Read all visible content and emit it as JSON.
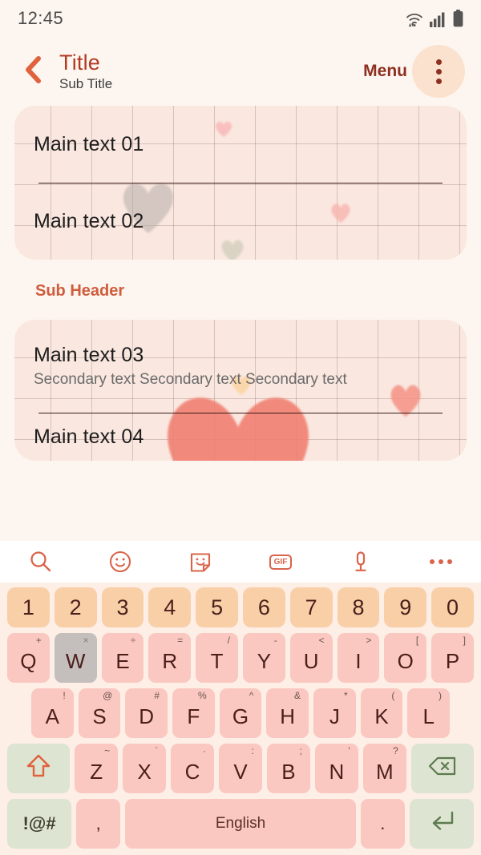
{
  "statusbar": {
    "time": "12:45",
    "icons": [
      "wifi-icon",
      "cellular-signal-icon",
      "battery-icon"
    ]
  },
  "appbar": {
    "back_icon": "chevron-left-icon",
    "title": "Title",
    "subtitle": "Sub Title",
    "menu_label": "Menu",
    "overflow_icon": "more-vertical-icon"
  },
  "colors": {
    "page_bg": "#fdf6f0",
    "card_bg": "#fae8e0",
    "accent_title": "#b23a23",
    "accent_menu": "#8e2f20",
    "sub_header": "#cf5c3c",
    "key_number": "#f9cfa8",
    "key_letter": "#fac8c0",
    "key_special": "#dde4d1",
    "key_pressed": "#c4bebc",
    "toolbar_icon": "#d9644a",
    "keyboard_bg": "#fdeee6"
  },
  "content": {
    "card1": {
      "rows": [
        {
          "main": "Main text 01"
        },
        {
          "main": "Main text 02"
        }
      ]
    },
    "sub_header": "Sub Header",
    "card2": {
      "rows": [
        {
          "main": "Main text 03",
          "secondary": "Secondary text Secondary text Secondary text"
        },
        {
          "main": "Main text 04"
        }
      ]
    }
  },
  "keyboard": {
    "toolbar": [
      {
        "name": "search-icon",
        "label": ""
      },
      {
        "name": "emoji-icon",
        "label": ""
      },
      {
        "name": "sticker-icon",
        "label": ""
      },
      {
        "name": "gif-icon",
        "label": "GIF"
      },
      {
        "name": "microphone-icon",
        "label": ""
      },
      {
        "name": "more-horizontal-icon",
        "label": ""
      }
    ],
    "row_numbers": [
      {
        "key": "1"
      },
      {
        "key": "2"
      },
      {
        "key": "3"
      },
      {
        "key": "4"
      },
      {
        "key": "5"
      },
      {
        "key": "6"
      },
      {
        "key": "7"
      },
      {
        "key": "8"
      },
      {
        "key": "9"
      },
      {
        "key": "0"
      }
    ],
    "row_q": [
      {
        "key": "Q",
        "sup": "+"
      },
      {
        "key": "W",
        "sup": "×",
        "pressed": true
      },
      {
        "key": "E",
        "sup": "÷"
      },
      {
        "key": "R",
        "sup": "="
      },
      {
        "key": "T",
        "sup": "/"
      },
      {
        "key": "Y",
        "sup": "-"
      },
      {
        "key": "U",
        "sup": "<"
      },
      {
        "key": "I",
        "sup": ">"
      },
      {
        "key": "O",
        "sup": "["
      },
      {
        "key": "P",
        "sup": "]"
      }
    ],
    "row_a": [
      {
        "key": "A",
        "sup": "!"
      },
      {
        "key": "S",
        "sup": "@"
      },
      {
        "key": "D",
        "sup": "#"
      },
      {
        "key": "F",
        "sup": "%"
      },
      {
        "key": "G",
        "sup": "^"
      },
      {
        "key": "H",
        "sup": "&"
      },
      {
        "key": "J",
        "sup": "*"
      },
      {
        "key": "K",
        "sup": "("
      },
      {
        "key": "L",
        "sup": ")"
      }
    ],
    "row_z": [
      {
        "key": "Z",
        "sup": "~"
      },
      {
        "key": "X",
        "sup": "`"
      },
      {
        "key": "C",
        "sup": "·"
      },
      {
        "key": "V",
        "sup": ":"
      },
      {
        "key": "B",
        "sup": ";"
      },
      {
        "key": "N",
        "sup": "'"
      },
      {
        "key": "M",
        "sup": "?"
      }
    ],
    "shift_icon": "shift-arrow-up-icon",
    "backspace_icon": "backspace-icon",
    "row_bottom": {
      "symbols_label": "!@#",
      "comma_label": ",",
      "space_label": "English",
      "period_label": ".",
      "enter_icon": "enter-return-icon"
    }
  }
}
